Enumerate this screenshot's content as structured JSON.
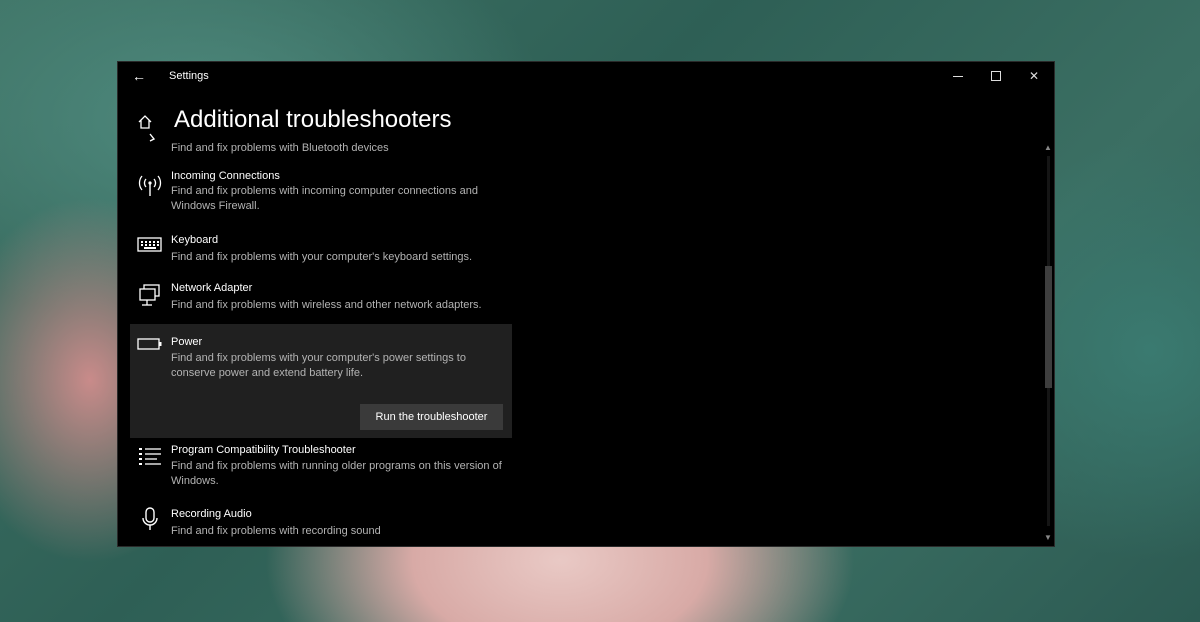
{
  "window": {
    "title": "Settings",
    "controls": {
      "minimize": "minimize",
      "maximize": "maximize",
      "close": "close"
    }
  },
  "header": {
    "page_title": "Additional troubleshooters"
  },
  "items": [
    {
      "name": "",
      "description": "Find and fix problems with Bluetooth devices",
      "icon": "bluetooth-icon"
    },
    {
      "name": "Incoming Connections",
      "description": "Find and fix problems with incoming computer connections and Windows Firewall.",
      "icon": "antenna-icon"
    },
    {
      "name": "Keyboard",
      "description": "Find and fix problems with your computer's keyboard settings.",
      "icon": "keyboard-icon"
    },
    {
      "name": "Network Adapter",
      "description": "Find and fix problems with wireless and other network adapters.",
      "icon": "network-icon"
    },
    {
      "name": "Power",
      "description": "Find and fix problems with your computer's power settings to conserve power and extend battery life.",
      "icon": "battery-icon",
      "selected": true,
      "action_label": "Run the troubleshooter"
    },
    {
      "name": "Program Compatibility Troubleshooter",
      "description": "Find and fix problems with running older programs on this version of Windows.",
      "icon": "list-icon"
    },
    {
      "name": "Recording Audio",
      "description": "Find and fix problems with recording sound",
      "icon": "microphone-icon"
    }
  ],
  "colors": {
    "window_bg": "#000000",
    "selected_bg": "#202020",
    "button_bg": "#3a3a3a",
    "text_primary": "#ffffff",
    "text_secondary": "#b3b3b3"
  }
}
